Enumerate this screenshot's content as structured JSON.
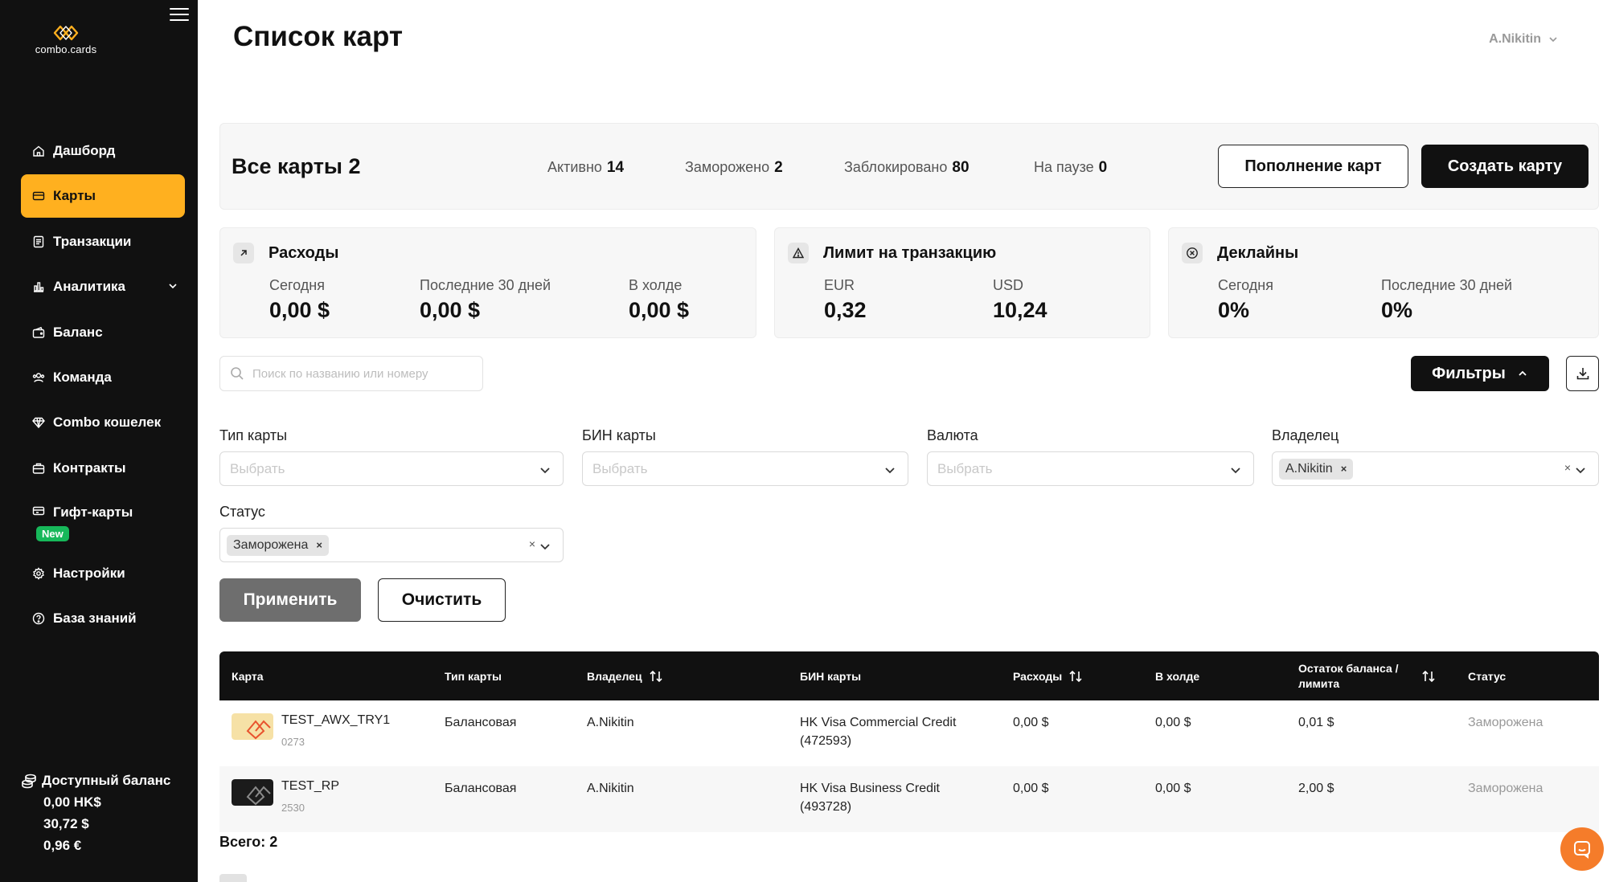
{
  "brand": {
    "name": "combo.cards"
  },
  "page": {
    "title": "Список карт"
  },
  "user": {
    "name": "A.Nikitin"
  },
  "sidebar": {
    "items": [
      {
        "label": "Дашборд",
        "icon": "home-icon"
      },
      {
        "label": "Карты",
        "icon": "card-icon",
        "active": true
      },
      {
        "label": "Транзакции",
        "icon": "transactions-icon"
      },
      {
        "label": "Аналитика",
        "icon": "analytics-icon",
        "expandable": true
      },
      {
        "label": "Баланс",
        "icon": "wallet-icon"
      },
      {
        "label": "Команда",
        "icon": "team-icon"
      },
      {
        "label": "Combo кошелек",
        "icon": "diamond-icon"
      },
      {
        "label": "Контракты",
        "icon": "briefcase-icon"
      },
      {
        "label": "Гифт-карты",
        "icon": "gift-card-icon",
        "badge": "New"
      },
      {
        "label": "Настройки",
        "icon": "gear-icon"
      },
      {
        "label": "База знаний",
        "icon": "help-icon"
      }
    ],
    "balance": {
      "title": "Доступный баланс",
      "lines": [
        "0,00 HK$",
        "30,72 $",
        "0,96 €"
      ]
    }
  },
  "summary": {
    "all_label": "Все карты",
    "all_count": "2",
    "stats": [
      {
        "label": "Активно",
        "value": "14"
      },
      {
        "label": "Заморожено",
        "value": "2"
      },
      {
        "label": "Заблокировано",
        "value": "80"
      },
      {
        "label": "На паузе",
        "value": "0"
      }
    ],
    "topup_label": "Пополнение карт",
    "create_label": "Создать карту"
  },
  "metrics": {
    "expenses": {
      "title": "Расходы",
      "items": [
        {
          "label": "Сегодня",
          "value": "0,00 $"
        },
        {
          "label": "Последние 30 дней",
          "value": "0,00 $"
        },
        {
          "label": "В холде",
          "value": "0,00 $"
        }
      ]
    },
    "limit": {
      "title": "Лимит на транзакцию",
      "items": [
        {
          "label": "EUR",
          "value": "0,32"
        },
        {
          "label": "USD",
          "value": "10,24"
        }
      ]
    },
    "declines": {
      "title": "Деклайны",
      "items": [
        {
          "label": "Сегодня",
          "value": "0%"
        },
        {
          "label": "Последние 30 дней",
          "value": "0%"
        }
      ]
    }
  },
  "search": {
    "placeholder": "Поиск по названию или номеру"
  },
  "filters": {
    "button_label": "Фильтры",
    "type": {
      "label": "Тип карты",
      "placeholder": "Выбрать"
    },
    "bin": {
      "label": "БИН карты",
      "placeholder": "Выбрать"
    },
    "currency": {
      "label": "Валюта",
      "placeholder": "Выбрать"
    },
    "owner": {
      "label": "Владелец",
      "selected": "A.Nikitin"
    },
    "status": {
      "label": "Статус",
      "selected": "Заморожена"
    },
    "apply_label": "Применить",
    "clear_label": "Очистить"
  },
  "table": {
    "headers": {
      "card": "Карта",
      "type": "Тип карты",
      "owner": "Владелец",
      "bin": "БИН карты",
      "expenses": "Расходы",
      "hold": "В холде",
      "balance_line1": "Остаток баланса /",
      "balance_line2": "лимита",
      "status": "Статус"
    },
    "rows": [
      {
        "name": "TEST_AWX_TRY1",
        "number": "0273",
        "thumb_color": "#F6E1A6",
        "type": "Балансовая",
        "owner": "A.Nikitin",
        "bin_line1": "HK Visa Commercial Credit",
        "bin_line2": "(472593)",
        "expenses": "0,00 $",
        "hold": "0,00 $",
        "balance": "0,01 $",
        "status": "Заморожена"
      },
      {
        "name": "TEST_RP",
        "number": "2530",
        "thumb_color": "#1B1B1B",
        "type": "Балансовая",
        "owner": "A.Nikitin",
        "bin_line1": "HK Visa Business Credit",
        "bin_line2": "(493728)",
        "expenses": "0,00 $",
        "hold": "0,00 $",
        "balance": "2,00 $",
        "status": "Заморожена"
      }
    ],
    "total": "Всего: 2"
  },
  "colors": {
    "accent": "#FFB01F",
    "sidebar_bg": "#111111",
    "badge_new": "#17B85A",
    "chat": "#F57C2A"
  }
}
